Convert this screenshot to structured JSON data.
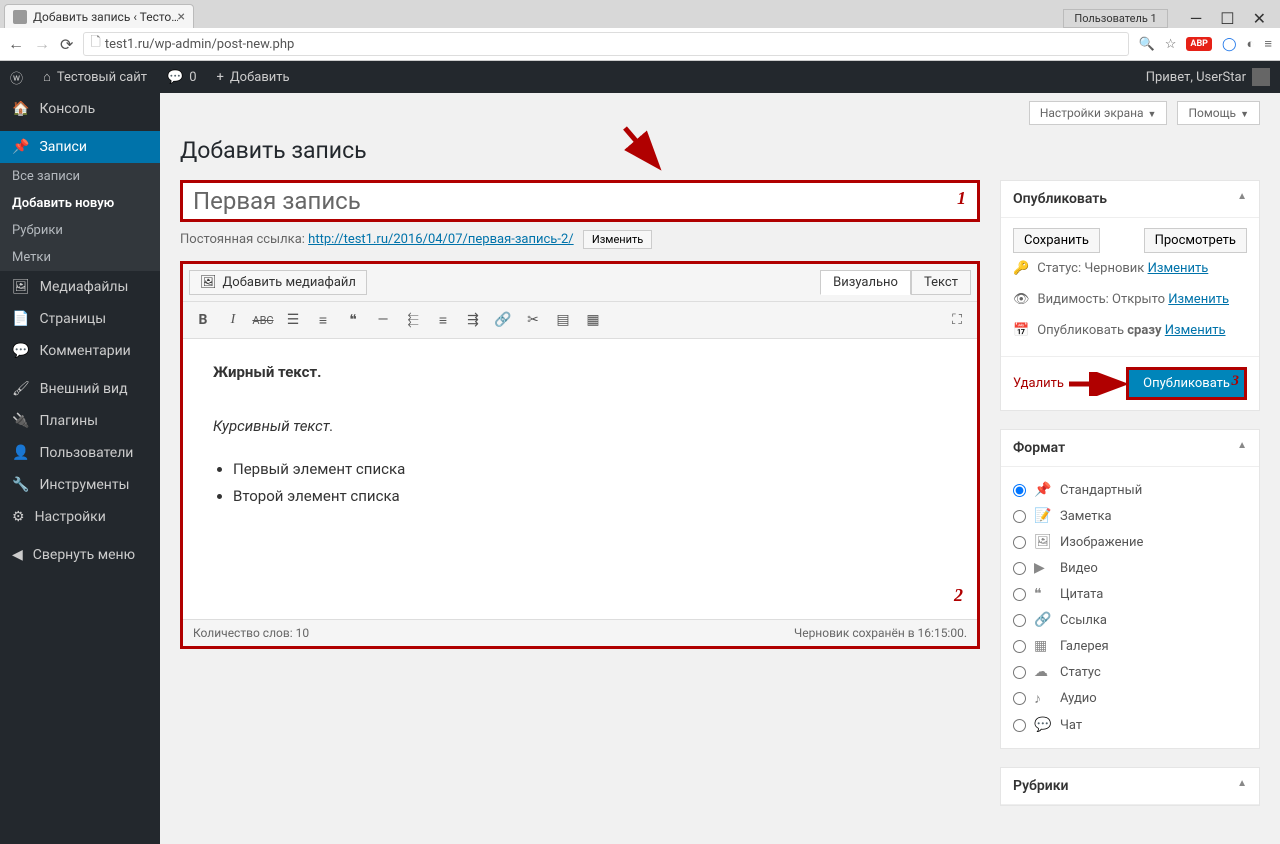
{
  "browser": {
    "tab_title": "Добавить запись ‹ Тесто…",
    "user_badge": "Пользователь 1",
    "url": "test1.ru/wp-admin/post-new.php"
  },
  "adminbar": {
    "site_name": "Тестовый сайт",
    "comments": "0",
    "add_new": "Добавить",
    "greeting": "Привет, UserStar"
  },
  "sidebar": {
    "dashboard": "Консоль",
    "posts": "Записи",
    "posts_sub": [
      "Все записи",
      "Добавить новую",
      "Рубрики",
      "Метки"
    ],
    "media": "Медиафайлы",
    "pages": "Страницы",
    "comments": "Комментарии",
    "appearance": "Внешний вид",
    "plugins": "Плагины",
    "users": "Пользователи",
    "tools": "Инструменты",
    "settings": "Настройки",
    "collapse": "Свернуть меню"
  },
  "top_buttons": {
    "screen_options": "Настройки экрана",
    "help": "Помощь"
  },
  "page": {
    "title": "Добавить запись",
    "post_title": "Первая запись",
    "permalink_label": "Постоянная ссылка:",
    "permalink_url": "http://test1.ru/2016/04/07/первая-запись-2/",
    "permalink_edit": "Изменить",
    "add_media": "Добавить медиафайл",
    "tab_visual": "Визуально",
    "tab_text": "Текст",
    "content_bold": "Жирный текст.",
    "content_italic": "Курсивный текст.",
    "content_li1": "Первый элемент списка",
    "content_li2": "Второй элемент списка",
    "word_count": "Количество слов: 10",
    "draft_saved": "Черновик сохранён в 16:15:00."
  },
  "publish": {
    "box_title": "Опубликовать",
    "save": "Сохранить",
    "preview": "Просмотреть",
    "status_label": "Статус:",
    "status_value": "Черновик",
    "visibility_label": "Видимость:",
    "visibility_value": "Открыто",
    "schedule_label": "Опубликовать",
    "schedule_value": "сразу",
    "edit_link": "Изменить",
    "delete": "Удалить",
    "publish_btn": "Опубликовать"
  },
  "format": {
    "box_title": "Формат",
    "items": [
      "Стандартный",
      "Заметка",
      "Изображение",
      "Видео",
      "Цитата",
      "Ссылка",
      "Галерея",
      "Статус",
      "Аудио",
      "Чат"
    ]
  },
  "categories": {
    "box_title": "Рубрики"
  },
  "markers": {
    "m1": "1",
    "m2": "2",
    "m3": "3"
  }
}
